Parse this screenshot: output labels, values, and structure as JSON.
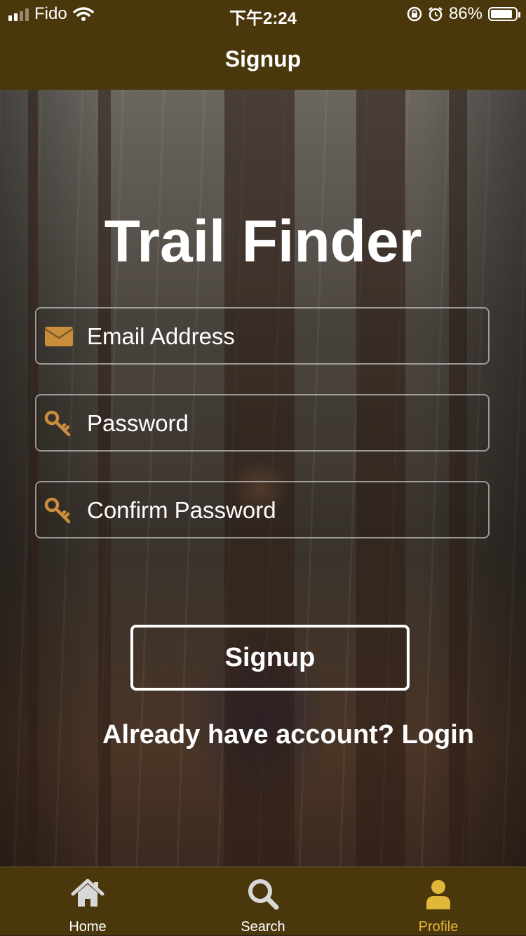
{
  "status_bar": {
    "carrier": "Fido",
    "time": "下午2:24",
    "battery": "86%",
    "battery_level": 0.86,
    "icons": [
      "signal-icon",
      "wifi-icon",
      "orientation-lock-icon",
      "alarm-icon",
      "battery-icon"
    ]
  },
  "nav": {
    "title": "Signup"
  },
  "app": {
    "title": "Trail Finder"
  },
  "form": {
    "email_placeholder": "Email Address",
    "email_icon": "envelope-icon",
    "password_placeholder": "Password",
    "password_icon": "key-icon",
    "confirm_placeholder": "Confirm Password",
    "confirm_icon": "key-icon",
    "submit_label": "Signup",
    "login_prompt": "Already have account? Login"
  },
  "tabs": [
    {
      "label": "Home",
      "icon": "home-icon",
      "active": false
    },
    {
      "label": "Search",
      "icon": "search-icon",
      "active": false
    },
    {
      "label": "Profile",
      "icon": "user-icon",
      "active": true
    }
  ],
  "colors": {
    "header": "#4a370c",
    "accent_active_tab": "#e0b73b",
    "input_icon": "#c98d3b",
    "tab_icon_inactive": "#d8d8d8"
  }
}
